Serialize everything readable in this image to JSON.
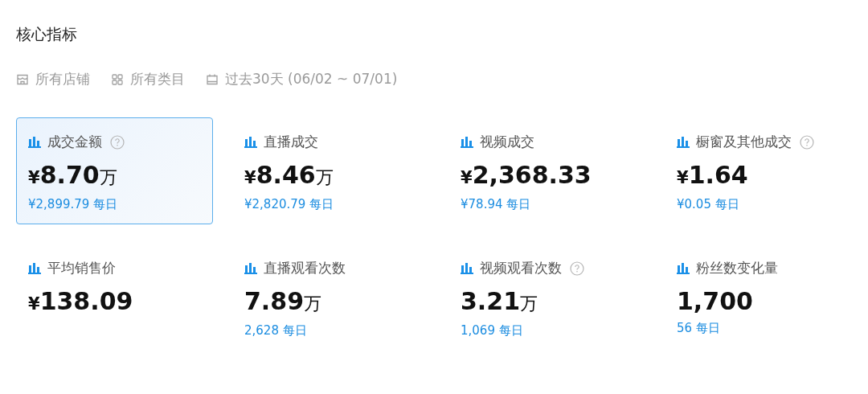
{
  "title": "核心指标",
  "filters": [
    {
      "kind": "store",
      "label": "所有店铺"
    },
    {
      "kind": "category",
      "label": "所有类目"
    },
    {
      "kind": "date",
      "label": "过去30天 (06/02 ~ 07/01)"
    }
  ],
  "metrics": [
    {
      "label": "成交金额",
      "help": true,
      "selected": true,
      "currency": "¥",
      "value": "8.70",
      "unit": "万",
      "daily": "¥2,899.79 每日"
    },
    {
      "label": "直播成交",
      "help": false,
      "selected": false,
      "currency": "¥",
      "value": "8.46",
      "unit": "万",
      "daily": "¥2,820.79 每日"
    },
    {
      "label": "视频成交",
      "help": false,
      "selected": false,
      "currency": "¥",
      "value": "2,368.33",
      "daily": "¥78.94 每日"
    },
    {
      "label": "橱窗及其他成交",
      "help": true,
      "selected": false,
      "currency": "¥",
      "value": "1.64",
      "daily": "¥0.05 每日"
    },
    {
      "label": "平均销售价",
      "help": false,
      "selected": false,
      "currency": "¥",
      "value": "138.09"
    },
    {
      "label": "直播观看次数",
      "help": false,
      "selected": false,
      "value": "7.89",
      "unit": "万",
      "daily": "2,628 每日"
    },
    {
      "label": "视频观看次数",
      "help": true,
      "selected": false,
      "value": "3.21",
      "unit": "万",
      "daily": "1,069 每日"
    },
    {
      "label": "粉丝数变化量",
      "help": false,
      "selected": false,
      "value": "1,700",
      "daily": "56 每日"
    }
  ]
}
